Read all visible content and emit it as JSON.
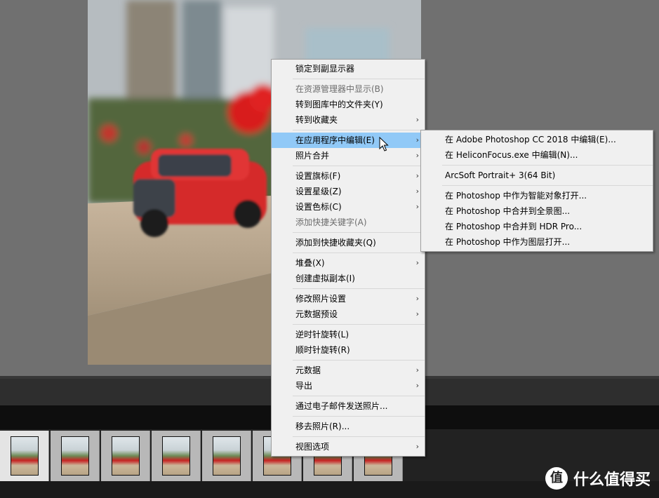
{
  "context_menu": {
    "items": [
      {
        "label": "锁定到副显示器"
      },
      {
        "sep": true
      },
      {
        "label": "在资源管理器中显示(B)",
        "disabled": true
      },
      {
        "label": "转到图库中的文件夹(Y)"
      },
      {
        "label": "转到收藏夹",
        "submenu": true
      },
      {
        "sep": true
      },
      {
        "label": "在应用程序中编辑(E)",
        "submenu": true,
        "highlighted": true
      },
      {
        "label": "照片合并",
        "submenu": true
      },
      {
        "sep": true
      },
      {
        "label": "设置旗标(F)",
        "submenu": true
      },
      {
        "label": "设置星级(Z)",
        "submenu": true
      },
      {
        "label": "设置色标(C)",
        "submenu": true
      },
      {
        "label": "添加快捷关键字(A)",
        "disabled": true
      },
      {
        "sep": true
      },
      {
        "label": "添加到快捷收藏夹(Q)"
      },
      {
        "sep": true
      },
      {
        "label": "堆叠(X)",
        "submenu": true
      },
      {
        "label": "创建虚拟副本(I)"
      },
      {
        "sep": true
      },
      {
        "label": "修改照片设置",
        "submenu": true
      },
      {
        "label": "元数据预设",
        "submenu": true
      },
      {
        "sep": true
      },
      {
        "label": "逆时针旋转(L)"
      },
      {
        "label": "顺时针旋转(R)"
      },
      {
        "sep": true
      },
      {
        "label": "元数据",
        "submenu": true
      },
      {
        "label": "导出",
        "submenu": true
      },
      {
        "sep": true
      },
      {
        "label": "通过电子邮件发送照片..."
      },
      {
        "sep": true
      },
      {
        "label": "移去照片(R)..."
      },
      {
        "sep": true
      },
      {
        "label": "视图选项",
        "submenu": true
      }
    ]
  },
  "submenu_edit_in": {
    "items": [
      {
        "label": "在 Adobe Photoshop CC 2018 中编辑(E)..."
      },
      {
        "label": "在 HeliconFocus.exe 中编辑(N)..."
      },
      {
        "sep": true
      },
      {
        "label": "ArcSoft Portrait+ 3(64 Bit)"
      },
      {
        "sep": true
      },
      {
        "label": "在 Photoshop 中作为智能对象打开..."
      },
      {
        "label": "在 Photoshop 中合并到全景图..."
      },
      {
        "label": "在 Photoshop 中合并到 HDR Pro..."
      },
      {
        "label": "在 Photoshop 中作为图层打开..."
      }
    ]
  },
  "submenu_arrow": "›",
  "filmstrip": {
    "thumb_count": 8,
    "selected_index": 0
  },
  "watermark": {
    "logo": "值",
    "text": "什么值得买"
  },
  "colors": {
    "menu_bg": "#f0f0f0",
    "highlight": "#91c9f7",
    "disabled_text": "#6d6d6d"
  }
}
